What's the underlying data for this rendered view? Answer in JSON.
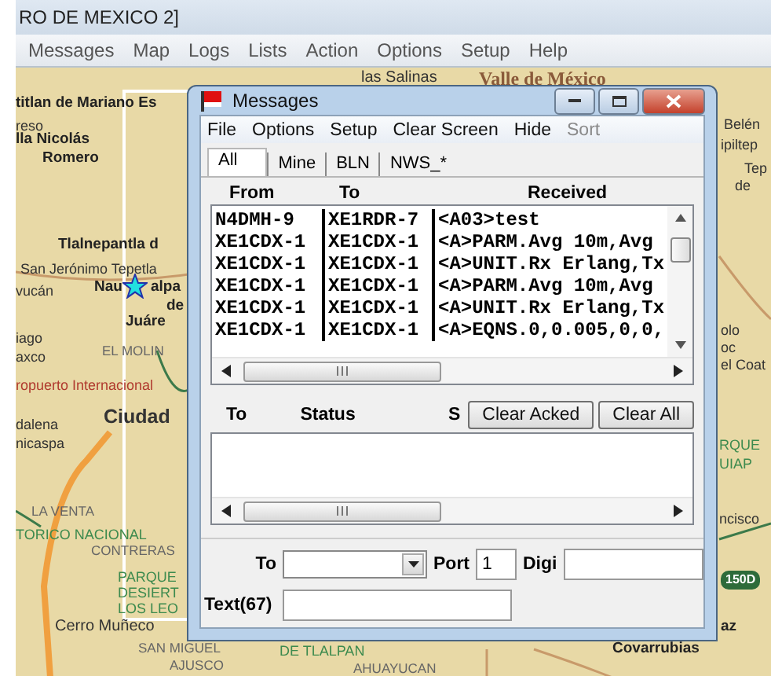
{
  "app_window": {
    "title": "RO DE MEXICO 2]",
    "menu": [
      "Messages",
      "Map",
      "Logs",
      "Lists",
      "Action",
      "Options",
      "Setup",
      "Help"
    ]
  },
  "map": {
    "labels": [
      {
        "text": "las Salinas",
        "kind": "place"
      },
      {
        "text": "Valle de México",
        "kind": "region"
      },
      {
        "text": "titlan de Mariano Es",
        "kind": "town"
      },
      {
        "text": "reso",
        "kind": "small"
      },
      {
        "text": "lla Nicolás",
        "kind": "town"
      },
      {
        "text": "Romero",
        "kind": "town"
      },
      {
        "text": "Tlalnepantla d",
        "kind": "town"
      },
      {
        "text": "San Jerónimo Tepetla",
        "kind": "small"
      },
      {
        "text": "vucán",
        "kind": "small"
      },
      {
        "text": "Nau",
        "kind": "town"
      },
      {
        "text": "alpa",
        "kind": "town"
      },
      {
        "text": "de",
        "kind": "town"
      },
      {
        "text": "Juáre",
        "kind": "town"
      },
      {
        "text": "iago",
        "kind": "small"
      },
      {
        "text": "axco",
        "kind": "small"
      },
      {
        "text": "EL MOLIN",
        "kind": "district"
      },
      {
        "text": "ropuerto Internacional",
        "kind": "airport"
      },
      {
        "text": "dalena",
        "kind": "small"
      },
      {
        "text": "nicaspa",
        "kind": "small"
      },
      {
        "text": "Ciudad",
        "kind": "city"
      },
      {
        "text": "LA VENTA",
        "kind": "district"
      },
      {
        "text": "TORICO NACIONAL",
        "kind": "park"
      },
      {
        "text": "CONTRERAS",
        "kind": "district"
      },
      {
        "text": "PARQUE",
        "kind": "park"
      },
      {
        "text": "DESIERT",
        "kind": "park"
      },
      {
        "text": "LOS LEO",
        "kind": "park"
      },
      {
        "text": "Cerro Muñeco",
        "kind": "place"
      },
      {
        "text": "SAN MIGUEL",
        "kind": "district"
      },
      {
        "text": "AJUSCO",
        "kind": "district"
      },
      {
        "text": "DE TLALPAN",
        "kind": "park"
      },
      {
        "text": "AHUAYUCAN",
        "kind": "district"
      },
      {
        "text": "az",
        "kind": "town"
      },
      {
        "text": "Covarrubias",
        "kind": "town"
      },
      {
        "text": "Belén",
        "kind": "small"
      },
      {
        "text": "ipiltep",
        "kind": "small"
      },
      {
        "text": "Tep",
        "kind": "small"
      },
      {
        "text": "de",
        "kind": "small"
      },
      {
        "text": "olo",
        "kind": "small"
      },
      {
        "text": "oc",
        "kind": "small"
      },
      {
        "text": "el Coat",
        "kind": "small"
      },
      {
        "text": "RQUE",
        "kind": "park"
      },
      {
        "text": "UIAP",
        "kind": "park"
      },
      {
        "text": "ncisco",
        "kind": "small"
      },
      {
        "text": "150D",
        "kind": "shield"
      }
    ]
  },
  "messages_window": {
    "title": "Messages",
    "menu": [
      {
        "label": "File",
        "disabled": false
      },
      {
        "label": "Options",
        "disabled": false
      },
      {
        "label": "Setup",
        "disabled": false
      },
      {
        "label": "Clear Screen",
        "disabled": false
      },
      {
        "label": "Hide",
        "disabled": false
      },
      {
        "label": "Sort",
        "disabled": true
      }
    ],
    "tabs": [
      {
        "label": "All",
        "selected": true
      },
      {
        "label": "Mine",
        "selected": false
      },
      {
        "label": "BLN",
        "selected": false
      },
      {
        "label": "NWS_*",
        "selected": false
      }
    ],
    "received": {
      "columns": [
        "From",
        "To",
        "Received"
      ],
      "rows": [
        [
          "N4DMH-9",
          "XE1RDR-7",
          "<A03>test"
        ],
        [
          "XE1CDX-1",
          "XE1CDX-1",
          "<A>PARM.Avg 10m,Avg"
        ],
        [
          "XE1CDX-1",
          "XE1CDX-1",
          "<A>UNIT.Rx Erlang,Tx"
        ],
        [
          "XE1CDX-1",
          "XE1CDX-1",
          "<A>PARM.Avg 10m,Avg"
        ],
        [
          "XE1CDX-1",
          "XE1CDX-1",
          "<A>UNIT.Rx Erlang,Tx"
        ],
        [
          "XE1CDX-1",
          "XE1CDX-1",
          "<A>EQNS.0,0.005,0,0,"
        ]
      ]
    },
    "outgoing": {
      "columns": [
        "To",
        "Status",
        "S"
      ],
      "buttons": [
        "Clear Acked",
        "Clear All"
      ]
    },
    "compose": {
      "to_label": "To",
      "port_label": "Port",
      "port_value": "1",
      "digi_label": "Digi",
      "text_label": "Text(67)"
    }
  }
}
